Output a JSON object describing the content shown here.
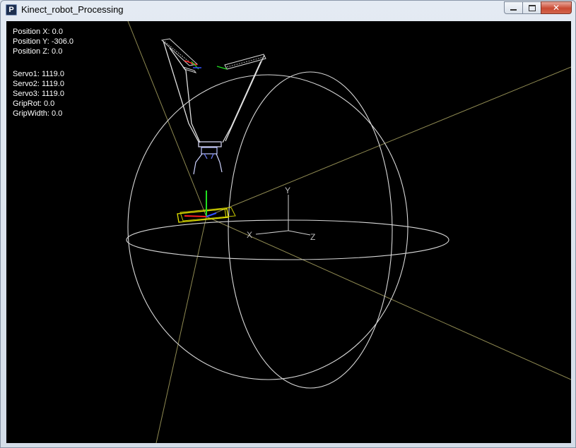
{
  "window": {
    "title": "Kinect_robot_Processing",
    "icon_letter": "P",
    "close_glyph": "✕"
  },
  "hud": {
    "position_x": "Position X: 0.0",
    "position_y": "Position Y: -306.0",
    "position_z": "Position Z: 0.0",
    "servo1": "Servo1: 1119.0",
    "servo2": "Servo2: 1119.0",
    "servo3": "Servo3: 1119.0",
    "grip_rot": "GripRot: 0.0",
    "grip_width": "GripWidth: 0.0"
  },
  "axes": {
    "x_label": "X",
    "y_label": "Y",
    "z_label": "Z"
  },
  "colors": {
    "sphere": "#d8d8d8",
    "guide_line": "#8f8a52",
    "target_box": "#e6e600",
    "axis_red": "#ff2020",
    "axis_green": "#20e020",
    "axis_blue": "#3050ff"
  }
}
